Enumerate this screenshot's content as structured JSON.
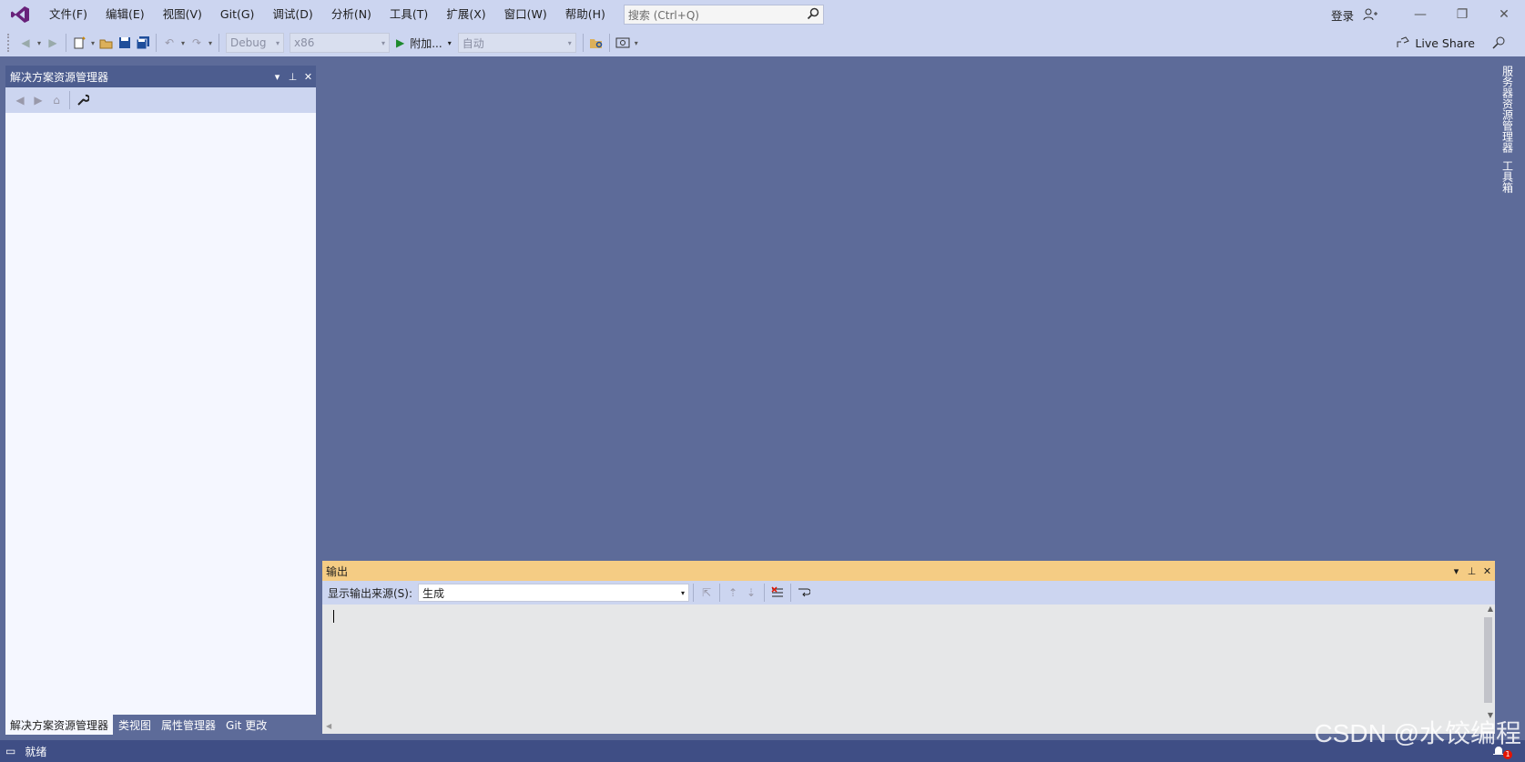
{
  "menu": [
    "文件(F)",
    "编辑(E)",
    "视图(V)",
    "Git(G)",
    "调试(D)",
    "分析(N)",
    "工具(T)",
    "扩展(X)",
    "窗口(W)",
    "帮助(H)"
  ],
  "search": {
    "placeholder": "搜索 (Ctrl+Q)"
  },
  "account": {
    "signin": "登录"
  },
  "toolbar": {
    "config": "Debug",
    "platform": "x86",
    "run_label": "附加...",
    "auto": "自动",
    "live_share": "Live Share"
  },
  "solution_explorer": {
    "title": "解决方案资源管理器"
  },
  "bottom_tabs": [
    "解决方案资源管理器",
    "类视图",
    "属性管理器",
    "Git 更改"
  ],
  "output": {
    "title": "输出",
    "source_label": "显示输出来源(S):",
    "source_value": "生成"
  },
  "right_tabs": [
    "服务器资源管理器",
    "工具箱"
  ],
  "status": {
    "text": "就绪"
  },
  "watermark": "CSDN @水饺编程",
  "notifications": {
    "count": "1"
  },
  "colors": {
    "accent": "#68217a",
    "title_bg": "#ccd5f0",
    "workspace": "#5d6b99",
    "output_tab": "#f5cc84",
    "status_bg": "#3f4e85"
  }
}
